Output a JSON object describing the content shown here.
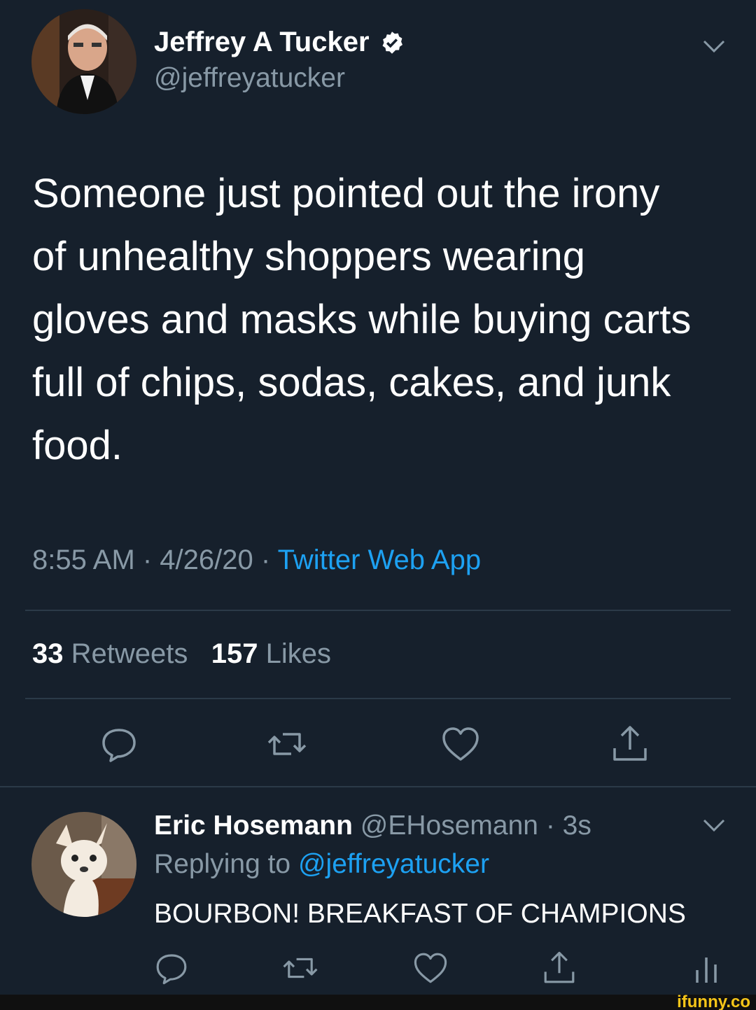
{
  "tweet": {
    "author_name": "Jeffrey A Tucker",
    "author_handle": "@jeffreyatucker",
    "text": "Someone just pointed out the irony\nof unhealthy shoppers wearing\ngloves and masks while buying carts\nfull of chips, sodas, cakes, and junk\nfood.",
    "time": "8:55 AM · 4/26/20 · ",
    "source": "Twitter Web App",
    "retweets_count": "33",
    "retweets_label": "Retweets",
    "likes_count": "157",
    "likes_label": "Likes"
  },
  "reply": {
    "author_name": "Eric Hosemann",
    "author_handle_time": " @EHosemann · 3s",
    "replying_label": "Replying to ",
    "replying_mention": "@jeffreyatucker",
    "text": "BOURBON! BREAKFAST OF CHAMPIONS"
  },
  "icons": {
    "reply": "reply-icon",
    "retweet": "retweet-icon",
    "like": "heart-icon",
    "share": "share-icon",
    "analytics": "analytics-icon",
    "verified": "verified-badge-icon",
    "more": "chevron-down-icon"
  },
  "watermark": "ifunny.co",
  "colors": {
    "background": "#16202c",
    "text_primary": "#ffffff",
    "text_secondary": "#8899a6",
    "accent": "#1da1f2",
    "divider": "#2b3a48"
  }
}
